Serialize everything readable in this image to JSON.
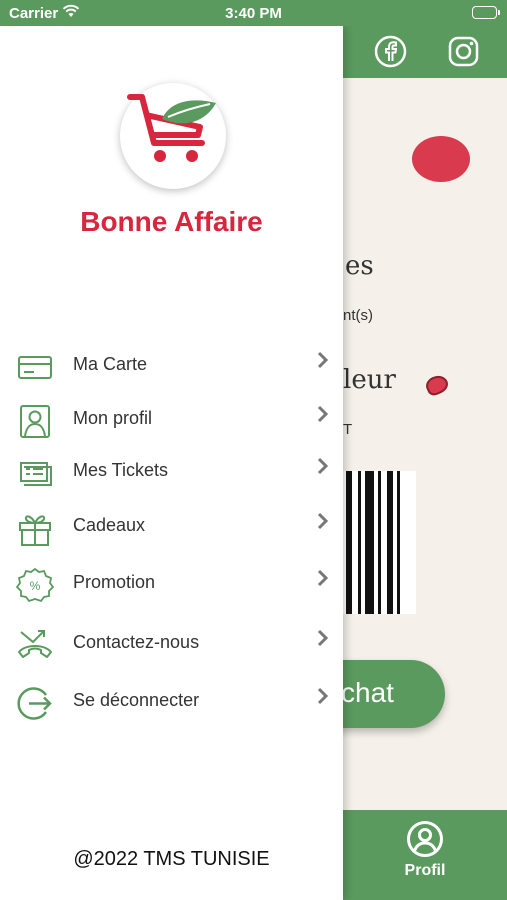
{
  "status_bar": {
    "carrier": "Carrier",
    "time": "3:40 PM"
  },
  "colors": {
    "primary_green": "#5b9a5e",
    "brand_red": "#d7263d"
  },
  "background_screen": {
    "header_icons": [
      "facebook-icon",
      "instagram-icon"
    ],
    "partial_text_1": "es",
    "partial_text_2": "nt(s)",
    "partial_text_3": "leur",
    "partial_text_4": "T",
    "button_label": "chat",
    "tab_label": "Profil"
  },
  "drawer": {
    "brand": "Bonne Affaire",
    "menu": [
      {
        "label": "Ma Carte",
        "icon": "card-icon"
      },
      {
        "label": "Mon profil",
        "icon": "profile-icon"
      },
      {
        "label": "Mes Tickets",
        "icon": "tickets-icon"
      },
      {
        "label": "Cadeaux",
        "icon": "gift-icon"
      },
      {
        "label": "Promotion",
        "icon": "promotion-icon"
      },
      {
        "label": "Contactez-nous",
        "icon": "phone-icon"
      },
      {
        "label": "Se déconnecter",
        "icon": "logout-icon"
      }
    ],
    "footer": "@2022 TMS TUNISIE"
  }
}
